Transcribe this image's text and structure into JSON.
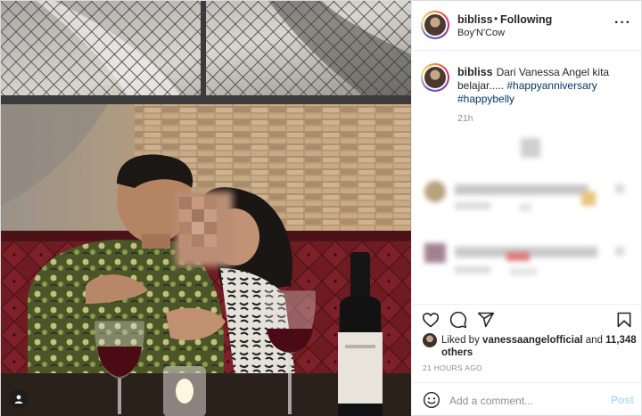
{
  "post": {
    "username": "bibliss",
    "follow_separator": "•",
    "follow_state": "Following",
    "location": "Boy'N'Cow",
    "more_icon": "more-horizontal-icon"
  },
  "caption": {
    "username": "bibliss",
    "text": "Dari Vanessa Angel kita belajar.....",
    "hashtags": [
      "#happyanniversary",
      "#happybelly"
    ],
    "time": "21h"
  },
  "actions": {
    "icons": [
      "heart-icon",
      "comment-icon",
      "share-icon",
      "bookmark-icon"
    ]
  },
  "likes": {
    "prefix": "Liked by",
    "user": "vanessaangelofficial",
    "conjunction": "and",
    "others": "11,348 others"
  },
  "post_time": "21 HOURS AGO",
  "comment_box": {
    "placeholder": "Add a comment...",
    "post_label": "Post"
  },
  "colors": {
    "accent_blue": "#0095f6",
    "post_button_disabled": "#b2dffc",
    "hashtag": "#00376b",
    "muted_text": "#8e8e8e",
    "border": "#dbdbdb"
  }
}
